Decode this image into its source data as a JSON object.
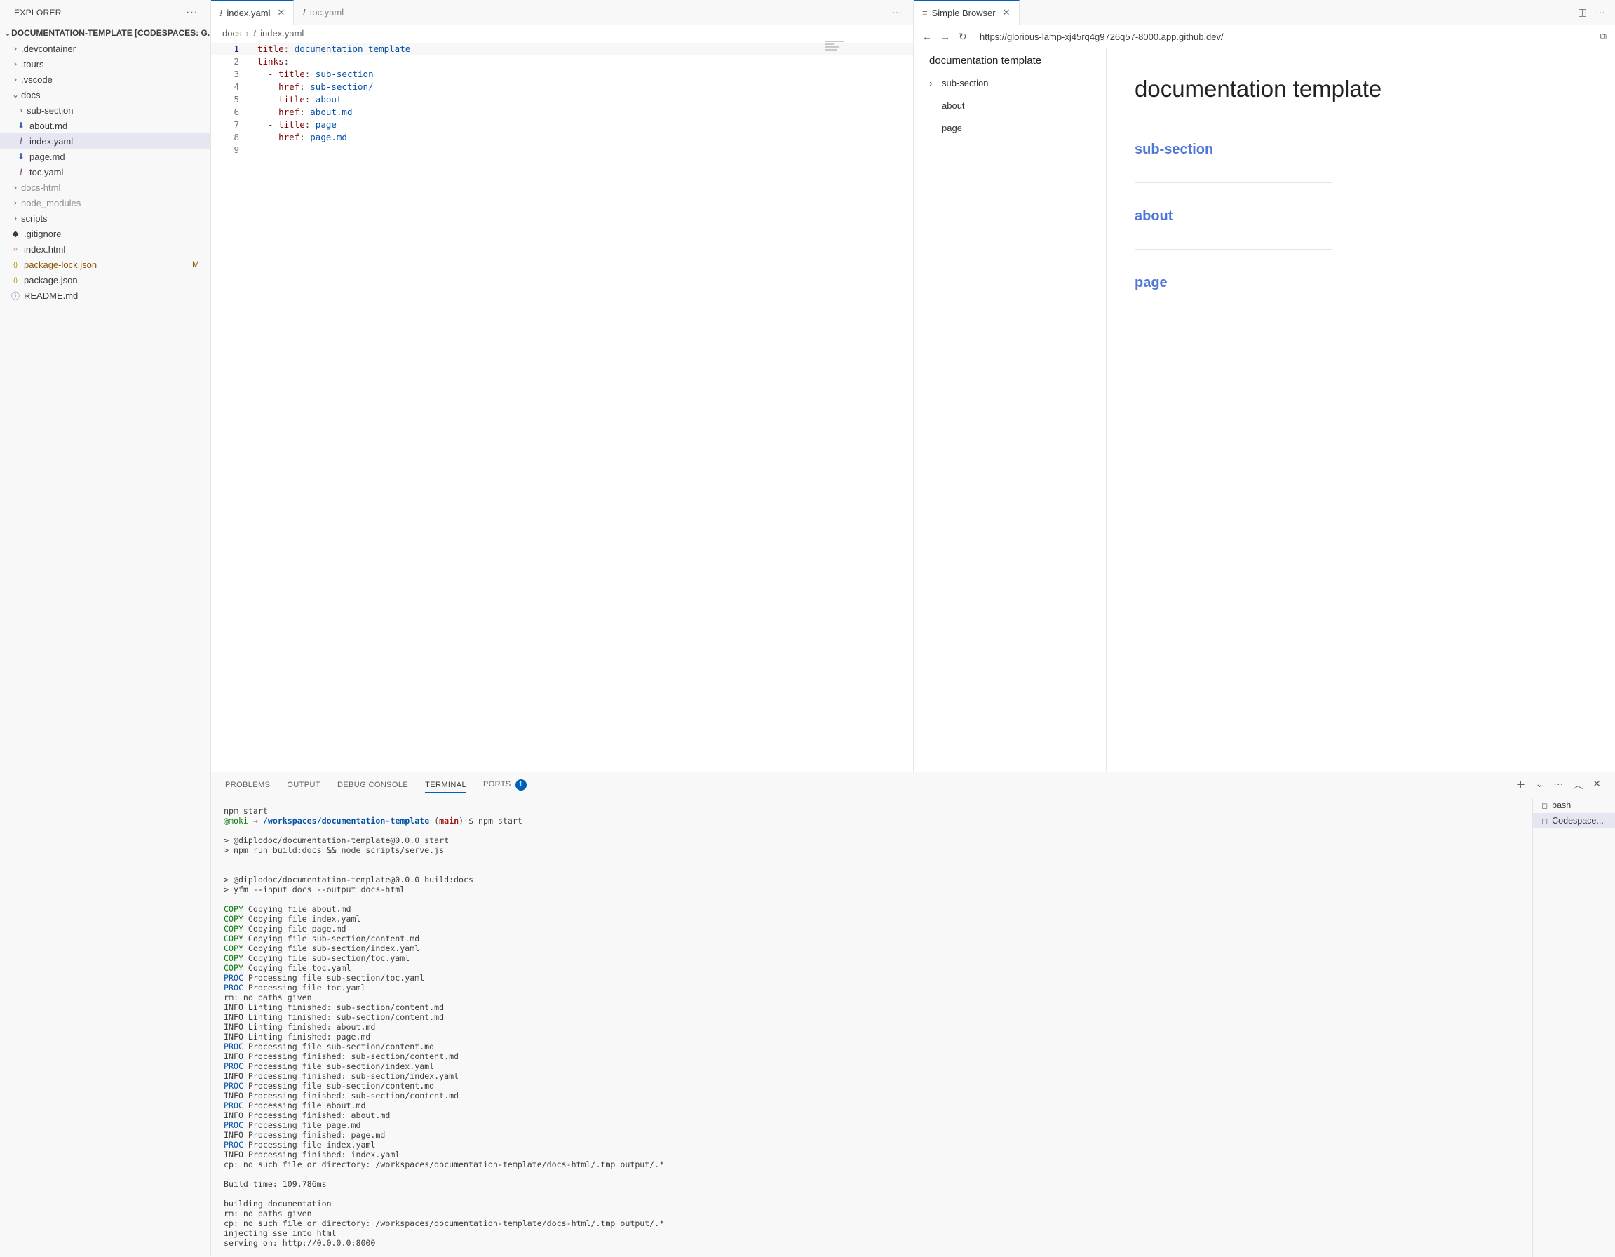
{
  "explorer": {
    "title": "EXPLORER",
    "more": "···",
    "project": "DOCUMENTATION-TEMPLATE [CODESPACES: G...",
    "items": [
      {
        "label": ".devcontainer",
        "type": "folder",
        "depth": 1
      },
      {
        "label": ".tours",
        "type": "folder",
        "depth": 1
      },
      {
        "label": ".vscode",
        "type": "folder",
        "depth": 1
      },
      {
        "label": "docs",
        "type": "folder-open",
        "depth": 1
      },
      {
        "label": "sub-section",
        "type": "folder",
        "depth": 2
      },
      {
        "label": "about.md",
        "type": "md",
        "depth": 2
      },
      {
        "label": "index.yaml",
        "type": "yaml",
        "depth": 2,
        "selected": true
      },
      {
        "label": "page.md",
        "type": "md",
        "depth": 2
      },
      {
        "label": "toc.yaml",
        "type": "yaml",
        "depth": 2
      },
      {
        "label": "docs-html",
        "type": "folder",
        "depth": 1,
        "ignored": true
      },
      {
        "label": "node_modules",
        "type": "folder",
        "depth": 1,
        "ignored": true
      },
      {
        "label": "scripts",
        "type": "folder",
        "depth": 1
      },
      {
        "label": ".gitignore",
        "type": "git",
        "depth": 1
      },
      {
        "label": "index.html",
        "type": "html",
        "depth": 1
      },
      {
        "label": "package-lock.json",
        "type": "json",
        "depth": 1,
        "modified": true,
        "badge": "M"
      },
      {
        "label": "package.json",
        "type": "json",
        "depth": 1
      },
      {
        "label": "README.md",
        "type": "info",
        "depth": 1
      }
    ]
  },
  "editor": {
    "tabs": [
      {
        "label": "index.yaml",
        "icon": "!",
        "active": true
      },
      {
        "label": "toc.yaml",
        "icon": "!",
        "active": false
      }
    ],
    "more": "···",
    "breadcrumb": [
      "docs",
      "index.yaml"
    ],
    "lines": [
      {
        "n": "1",
        "key": "title",
        "val": " documentation template",
        "indent": ""
      },
      {
        "n": "2",
        "key": "links",
        "val": "",
        "indent": ""
      },
      {
        "n": "3",
        "key": "title",
        "val": " sub-section",
        "indent": "  - "
      },
      {
        "n": "4",
        "key": "href",
        "val": " sub-section/",
        "indent": "    "
      },
      {
        "n": "5",
        "key": "title",
        "val": " about",
        "indent": "  - "
      },
      {
        "n": "6",
        "key": "href",
        "val": " about.md",
        "indent": "    "
      },
      {
        "n": "7",
        "key": "title",
        "val": " page",
        "indent": "  - "
      },
      {
        "n": "8",
        "key": "href",
        "val": " page.md",
        "indent": "    "
      },
      {
        "n": "9",
        "key": "",
        "val": "",
        "indent": ""
      }
    ]
  },
  "browser": {
    "tab_label": "Simple Browser",
    "url": "https://glorious-lamp-xj45rq4g9726q57-8000.app.github.dev/",
    "toc_title": "documentation template",
    "toc_items": [
      "sub-section",
      "about",
      "page"
    ],
    "heading": "documentation template",
    "links": [
      "sub-section",
      "about",
      "page"
    ]
  },
  "panel": {
    "tabs": [
      "PROBLEMS",
      "OUTPUT",
      "DEBUG CONSOLE",
      "TERMINAL",
      "PORTS"
    ],
    "ports_badge": "1",
    "terminals": [
      "bash",
      "Codespace..."
    ],
    "prompt_user": "@moki",
    "prompt_arrow": " → ",
    "prompt_path": "/workspaces/documentation-template",
    "prompt_branch": "main",
    "prompt_cmd": " $ npm start",
    "lines": [
      {
        "tag": "",
        "text": "npm start"
      },
      {
        "tag": "PROMPT",
        "text": ""
      },
      {
        "tag": "",
        "text": ""
      },
      {
        "tag": "",
        "text": "> @diplodoc/documentation-template@0.0.0 start"
      },
      {
        "tag": "",
        "text": "> npm run build:docs && node scripts/serve.js"
      },
      {
        "tag": "",
        "text": ""
      },
      {
        "tag": "",
        "text": ""
      },
      {
        "tag": "",
        "text": "> @diplodoc/documentation-template@0.0.0 build:docs"
      },
      {
        "tag": "",
        "text": "> yfm --input docs --output docs-html"
      },
      {
        "tag": "",
        "text": ""
      },
      {
        "tag": "COPY",
        "text": " Copying file about.md"
      },
      {
        "tag": "COPY",
        "text": " Copying file index.yaml"
      },
      {
        "tag": "COPY",
        "text": " Copying file page.md"
      },
      {
        "tag": "COPY",
        "text": " Copying file sub-section/content.md"
      },
      {
        "tag": "COPY",
        "text": " Copying file sub-section/index.yaml"
      },
      {
        "tag": "COPY",
        "text": " Copying file sub-section/toc.yaml"
      },
      {
        "tag": "COPY",
        "text": " Copying file toc.yaml"
      },
      {
        "tag": "PROC",
        "text": " Processing file sub-section/toc.yaml"
      },
      {
        "tag": "PROC",
        "text": " Processing file toc.yaml"
      },
      {
        "tag": "",
        "text": "rm: no paths given"
      },
      {
        "tag": "",
        "text": "INFO Linting finished: sub-section/content.md"
      },
      {
        "tag": "",
        "text": "INFO Linting finished: sub-section/content.md"
      },
      {
        "tag": "",
        "text": "INFO Linting finished: about.md"
      },
      {
        "tag": "",
        "text": "INFO Linting finished: page.md"
      },
      {
        "tag": "PROC",
        "text": " Processing file sub-section/content.md"
      },
      {
        "tag": "",
        "text": "INFO Processing finished: sub-section/content.md"
      },
      {
        "tag": "PROC",
        "text": " Processing file sub-section/index.yaml"
      },
      {
        "tag": "",
        "text": "INFO Processing finished: sub-section/index.yaml"
      },
      {
        "tag": "PROC",
        "text": " Processing file sub-section/content.md"
      },
      {
        "tag": "",
        "text": "INFO Processing finished: sub-section/content.md"
      },
      {
        "tag": "PROC",
        "text": " Processing file about.md"
      },
      {
        "tag": "",
        "text": "INFO Processing finished: about.md"
      },
      {
        "tag": "PROC",
        "text": " Processing file page.md"
      },
      {
        "tag": "",
        "text": "INFO Processing finished: page.md"
      },
      {
        "tag": "PROC",
        "text": " Processing file index.yaml"
      },
      {
        "tag": "",
        "text": "INFO Processing finished: index.yaml"
      },
      {
        "tag": "",
        "text": "cp: no such file or directory: /workspaces/documentation-template/docs-html/.tmp_output/.*"
      },
      {
        "tag": "",
        "text": ""
      },
      {
        "tag": "",
        "text": "Build time: 109.786ms"
      },
      {
        "tag": "",
        "text": ""
      },
      {
        "tag": "",
        "text": "building documentation"
      },
      {
        "tag": "",
        "text": "rm: no paths given"
      },
      {
        "tag": "",
        "text": "cp: no such file or directory: /workspaces/documentation-template/docs-html/.tmp_output/.*"
      },
      {
        "tag": "",
        "text": "injecting sse into html"
      },
      {
        "tag": "",
        "text": "serving on: http://0.0.0.0:8000"
      }
    ]
  },
  "colors": {
    "accent": "#005fb8",
    "link": "#4f77d9",
    "modified": "#895503"
  }
}
